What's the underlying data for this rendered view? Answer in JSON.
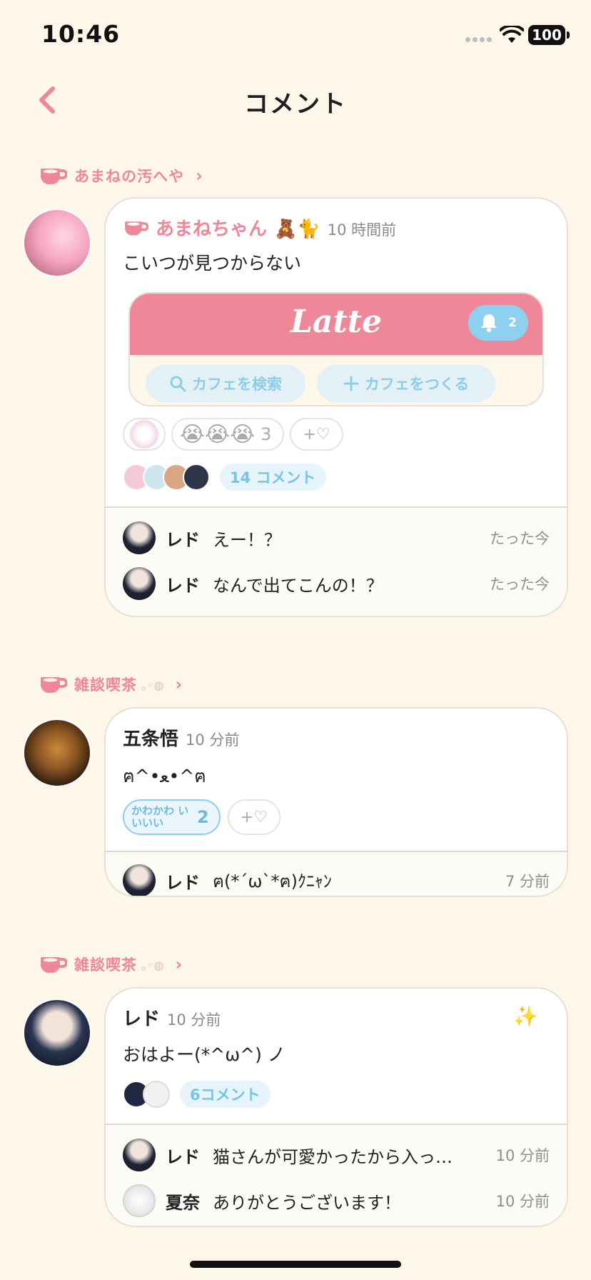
{
  "status": {
    "time": "10:46",
    "battery": "100"
  },
  "nav": {
    "title": "コメント"
  },
  "posts": [
    {
      "cafe": "あまねの汚へや",
      "author": "あまねちゃん",
      "author_emoji": "🧸🐈",
      "ago": "10 時間前",
      "text": "こいつが見つからない",
      "embed": {
        "logo": "Latte",
        "bell_count": "2",
        "search_label": "カフェを検索",
        "create_label": "カフェをつくる"
      },
      "reaction_emoji": "😭😭😭",
      "reaction_count": "3",
      "add_reaction": "+♡",
      "comments_label": "14 コメント",
      "replies": [
        {
          "name": "レド",
          "text": "えー！？",
          "time": "たった今"
        },
        {
          "name": "レド",
          "text": "なんで出てこんの！？",
          "time": "たった今"
        }
      ]
    },
    {
      "cafe": "雑談喫茶",
      "cafe_deco": "｡◦◍",
      "author": "五条悟",
      "ago": "10 分前",
      "text": "ฅ^•ﻌ•^ฅ",
      "stamp_label": "かわかわ いいいい",
      "stamp_count": "2",
      "add_reaction": "+♡",
      "replies": [
        {
          "name": "レド",
          "text": "ฅ(*´ω`*ฅ)ｸﾆｬﾝ",
          "time": "7 分前"
        }
      ]
    },
    {
      "cafe": "雑談喫茶",
      "cafe_deco": "｡◦◍",
      "author": "レド",
      "ago": "10 分前",
      "sparkle": "✨",
      "text": "おはよー(*^ω^) ノ",
      "comments_label": "6コメント",
      "replies": [
        {
          "name": "レド",
          "text": "猫さんが可愛かったから入っ…",
          "time": "10 分前"
        },
        {
          "name": "夏奈",
          "text": "ありがとうございます！",
          "time": "10 分前"
        }
      ]
    }
  ]
}
